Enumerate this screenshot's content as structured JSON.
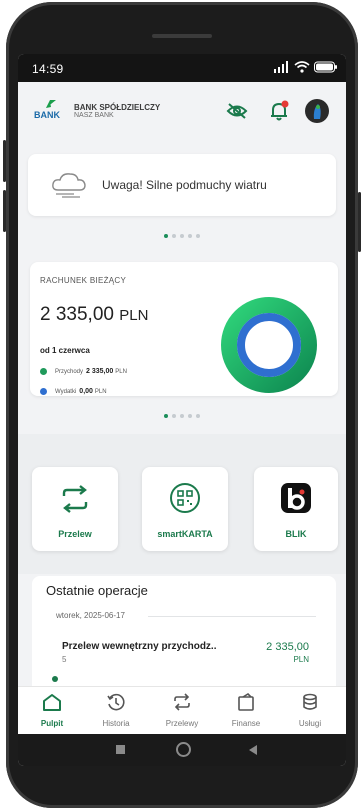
{
  "status_bar": {
    "time": "14:59"
  },
  "header": {
    "bank_name": "BANK SPÓŁDZIELCZY",
    "bank_subtitle": "NASZ BANK",
    "logo_text": "BANK"
  },
  "alert": {
    "text": "Uwaga! Silne podmuchy wiatru",
    "icon": "wind-cloud-icon"
  },
  "account": {
    "title": "RACHUNEK BIEŻĄCY",
    "balance": "2 335,00",
    "currency": "PLN",
    "period": "od 1 czerwca",
    "income_label": "Przychody",
    "income_value": "2 335,00",
    "income_currency": "PLN",
    "expense_label": "Wydatki",
    "expense_value": "0,00",
    "expense_currency": "PLN",
    "income_color": "#1f9a5b",
    "expense_color": "#2f6fd0"
  },
  "tiles": [
    {
      "label": "Przelew",
      "icon": "transfer-arrows-icon"
    },
    {
      "label": "smartKARTA",
      "icon": "qr-code-icon"
    },
    {
      "label": "BLIK",
      "icon": "blik-icon"
    }
  ],
  "operations": {
    "title": "Ostatnie operacje",
    "date": "wtorek, 2025-06-17",
    "items": [
      {
        "title": "Przelew wewnętrzny przychodz..",
        "sub": "5",
        "amount": "2 335,00",
        "currency": "PLN"
      }
    ]
  },
  "bottom_nav": [
    {
      "label": "Pulpit",
      "icon": "home-icon",
      "active": true
    },
    {
      "label": "Historia",
      "icon": "history-icon",
      "active": false
    },
    {
      "label": "Przelewy",
      "icon": "transfers-icon",
      "active": false
    },
    {
      "label": "Finanse",
      "icon": "finance-icon",
      "active": false
    },
    {
      "label": "Usługi",
      "icon": "services-icon",
      "active": false
    }
  ],
  "colors": {
    "brand_green": "#1b7a4c",
    "accent_red": "#e53935"
  }
}
